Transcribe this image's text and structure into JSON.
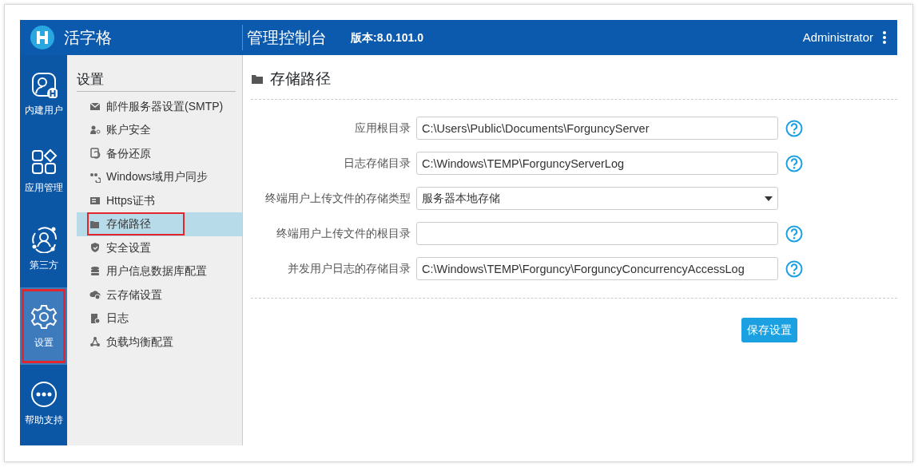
{
  "header": {
    "brand": "活字格",
    "title": "管理控制台",
    "version": "版本:8.0.101.0",
    "user": "Administrator"
  },
  "rail": [
    {
      "label": "内建用户",
      "selected": false
    },
    {
      "label": "应用管理",
      "selected": false
    },
    {
      "label": "第三方",
      "selected": false
    },
    {
      "label": "设置",
      "selected": true
    },
    {
      "label": "帮助支持",
      "selected": false
    }
  ],
  "submenu": {
    "title": "设置",
    "items": [
      {
        "label": "邮件服务器设置(SMTP)",
        "selected": false
      },
      {
        "label": "账户安全",
        "selected": false
      },
      {
        "label": "备份还原",
        "selected": false
      },
      {
        "label": "Windows域用户同步",
        "selected": false
      },
      {
        "label": "Https证书",
        "selected": false
      },
      {
        "label": "存储路径",
        "selected": true
      },
      {
        "label": "安全设置",
        "selected": false
      },
      {
        "label": "用户信息数据库配置",
        "selected": false
      },
      {
        "label": "云存储设置",
        "selected": false
      },
      {
        "label": "日志",
        "selected": false
      },
      {
        "label": "负载均衡配置",
        "selected": false
      }
    ]
  },
  "page": {
    "title": "存储路径",
    "fields": [
      {
        "label": "应用根目录",
        "kind": "text",
        "value": "C:\\Users\\Public\\Documents\\ForguncyServer",
        "help": true
      },
      {
        "label": "日志存储目录",
        "kind": "text",
        "value": "C:\\Windows\\TEMP\\ForguncyServerLog",
        "help": true
      },
      {
        "label": "终端用户上传文件的存储类型",
        "kind": "select",
        "value": "服务器本地存储",
        "help": false
      },
      {
        "label": "终端用户上传文件的根目录",
        "kind": "text",
        "help": true
      },
      {
        "label": "并发用户日志的存储目录",
        "kind": "text",
        "value": "C:\\Windows\\TEMP\\Forguncy\\ForguncyConcurrencyAccessLog",
        "help": true
      }
    ],
    "save_button": "保存设置"
  }
}
